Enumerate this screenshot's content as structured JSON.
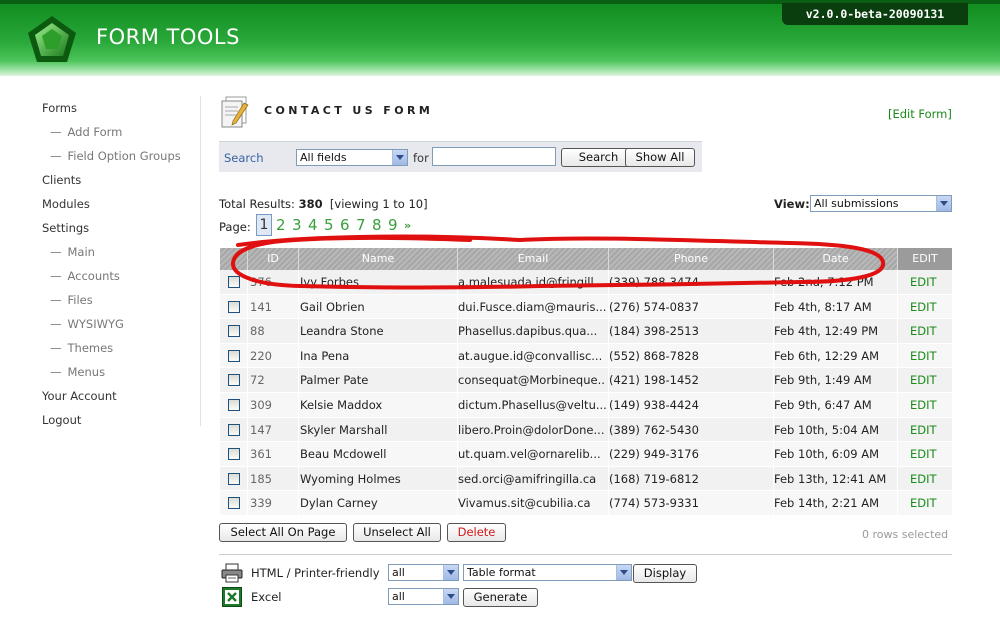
{
  "header": {
    "app_title": "FORM TOOLS",
    "version": "v2.0.0-beta-20090131",
    "logo_icon": "green-pentagon-logo-icon"
  },
  "sidebar": {
    "items": [
      {
        "label": "Forms",
        "level": 0
      },
      {
        "label": "Add Form",
        "level": 1
      },
      {
        "label": "Field Option Groups",
        "level": 1
      },
      {
        "label": "Clients",
        "level": 0
      },
      {
        "label": "Modules",
        "level": 0
      },
      {
        "label": "Settings",
        "level": 0
      },
      {
        "label": "Main",
        "level": 1
      },
      {
        "label": "Accounts",
        "level": 1
      },
      {
        "label": "Files",
        "level": 1
      },
      {
        "label": "WYSIWYG",
        "level": 1
      },
      {
        "label": "Themes",
        "level": 1
      },
      {
        "label": "Menus",
        "level": 1
      },
      {
        "label": "Your Account",
        "level": 0
      },
      {
        "label": "Logout",
        "level": 0
      }
    ]
  },
  "main": {
    "form_title": "CONTACT US FORM",
    "edit_form_link": "[Edit Form]",
    "search": {
      "label": "Search",
      "field_select": "All fields",
      "for_label": "for",
      "query_value": "",
      "search_button": "Search",
      "show_all_button": "Show All"
    },
    "results": {
      "prefix": "Total Results:",
      "total": "380",
      "viewing": "[viewing 1 to 10]"
    },
    "view": {
      "label": "View:",
      "selected": "All submissions"
    },
    "pagination": {
      "label": "Page:",
      "current": "1",
      "pages": [
        "2",
        "3",
        "4",
        "5",
        "6",
        "7",
        "8",
        "9"
      ],
      "next": "»"
    },
    "table": {
      "columns": [
        "ID",
        "Name",
        "Email",
        "Phone",
        "Date",
        "EDIT"
      ],
      "edit_label": "EDIT",
      "rows": [
        {
          "id": "376",
          "name": "Ivy Forbes",
          "email": "a.malesuada.id@fringill...",
          "phone": "(339) 788-3474",
          "date": "Feb 2nd, 7:12 PM"
        },
        {
          "id": "141",
          "name": "Gail Obrien",
          "email": "dui.Fusce.diam@mauris...",
          "phone": "(276) 574-0837",
          "date": "Feb 4th, 8:17 AM"
        },
        {
          "id": "88",
          "name": "Leandra Stone",
          "email": "Phasellus.dapibus.qua...",
          "phone": "(184) 398-2513",
          "date": "Feb 4th, 12:49 PM"
        },
        {
          "id": "220",
          "name": "Ina Pena",
          "email": "at.augue.id@convallisc...",
          "phone": "(552) 868-7828",
          "date": "Feb 6th, 12:29 AM"
        },
        {
          "id": "72",
          "name": "Palmer Pate",
          "email": "consequat@Morbineque...",
          "phone": "(421) 198-1452",
          "date": "Feb 9th, 1:49 AM"
        },
        {
          "id": "309",
          "name": "Kelsie Maddox",
          "email": "dictum.Phasellus@veltu...",
          "phone": "(149) 938-4424",
          "date": "Feb 9th, 6:47 AM"
        },
        {
          "id": "147",
          "name": "Skyler Marshall",
          "email": "libero.Proin@dolorDone...",
          "phone": "(389) 762-5430",
          "date": "Feb 10th, 5:04 AM"
        },
        {
          "id": "361",
          "name": "Beau Mcdowell",
          "email": "ut.quam.vel@ornarelib...",
          "phone": "(229) 949-3176",
          "date": "Feb 10th, 6:09 AM"
        },
        {
          "id": "185",
          "name": "Wyoming Holmes",
          "email": "sed.orci@amifringilla.ca",
          "phone": "(168) 719-6812",
          "date": "Feb 13th, 12:41 AM"
        },
        {
          "id": "339",
          "name": "Dylan Carney",
          "email": "Vivamus.sit@cubilia.ca",
          "phone": "(774) 573-9331",
          "date": "Feb 14th, 2:21 AM"
        }
      ]
    },
    "actions": {
      "select_all": "Select All On Page",
      "unselect_all": "Unselect All",
      "delete": "Delete",
      "rows_selected": "0 rows selected"
    },
    "export": {
      "html_label": "HTML / Printer-friendly",
      "html_scope": "all",
      "html_format": "Table format",
      "display_button": "Display",
      "excel_label": "Excel",
      "excel_scope": "all",
      "generate_button": "Generate"
    },
    "annotation_color": "#e01010"
  }
}
